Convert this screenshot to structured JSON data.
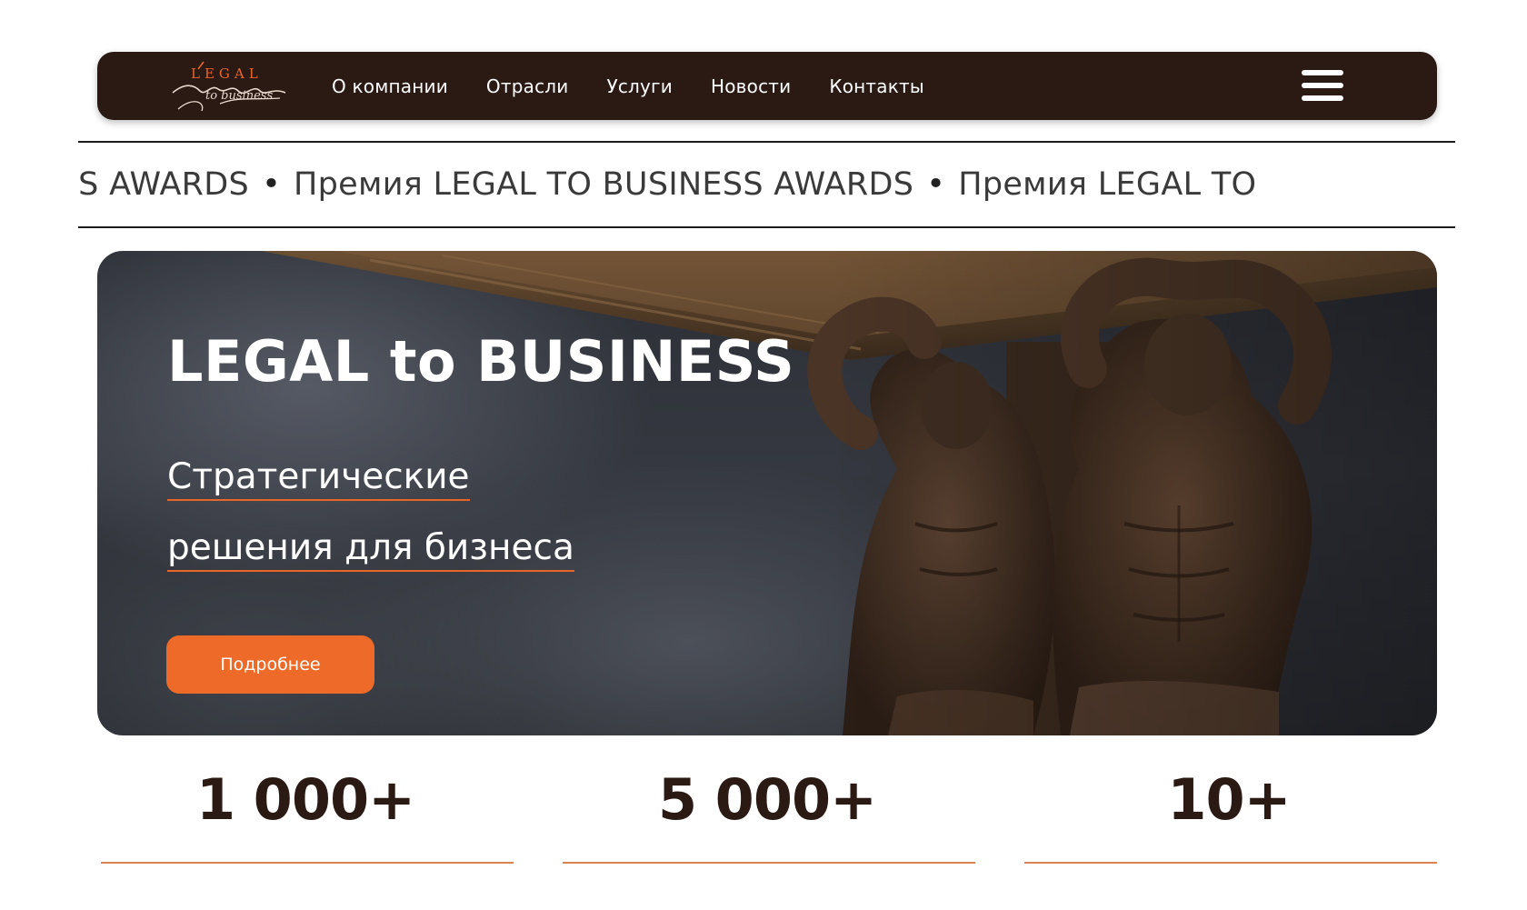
{
  "header": {
    "logo": {
      "word": "LEGAL",
      "script": "to business"
    },
    "nav": [
      {
        "label": "О компании"
      },
      {
        "label": "Отрасли"
      },
      {
        "label": "Услуги"
      },
      {
        "label": "Новости"
      },
      {
        "label": "Контакты"
      }
    ],
    "menu_icon": "hamburger-menu-icon"
  },
  "ticker": {
    "items": [
      "JSINESS AWARDS",
      "Премия LEGAL TO BUSINESS AWARDS",
      "Премия LEGAL TO"
    ],
    "separator": "•"
  },
  "hero": {
    "title": "LEGAL to BUSINESS",
    "subtitle_lines": [
      "Стратегические",
      "решения для бизнеса"
    ],
    "cta_label": "Подробнее"
  },
  "stats": [
    {
      "value": "1 000+"
    },
    {
      "value": "5 000+"
    },
    {
      "value": "10+"
    }
  ],
  "colors": {
    "brand_dark": "#2a1a13",
    "accent_orange": "#ee6a28",
    "underline_orange": "#e8662a"
  }
}
